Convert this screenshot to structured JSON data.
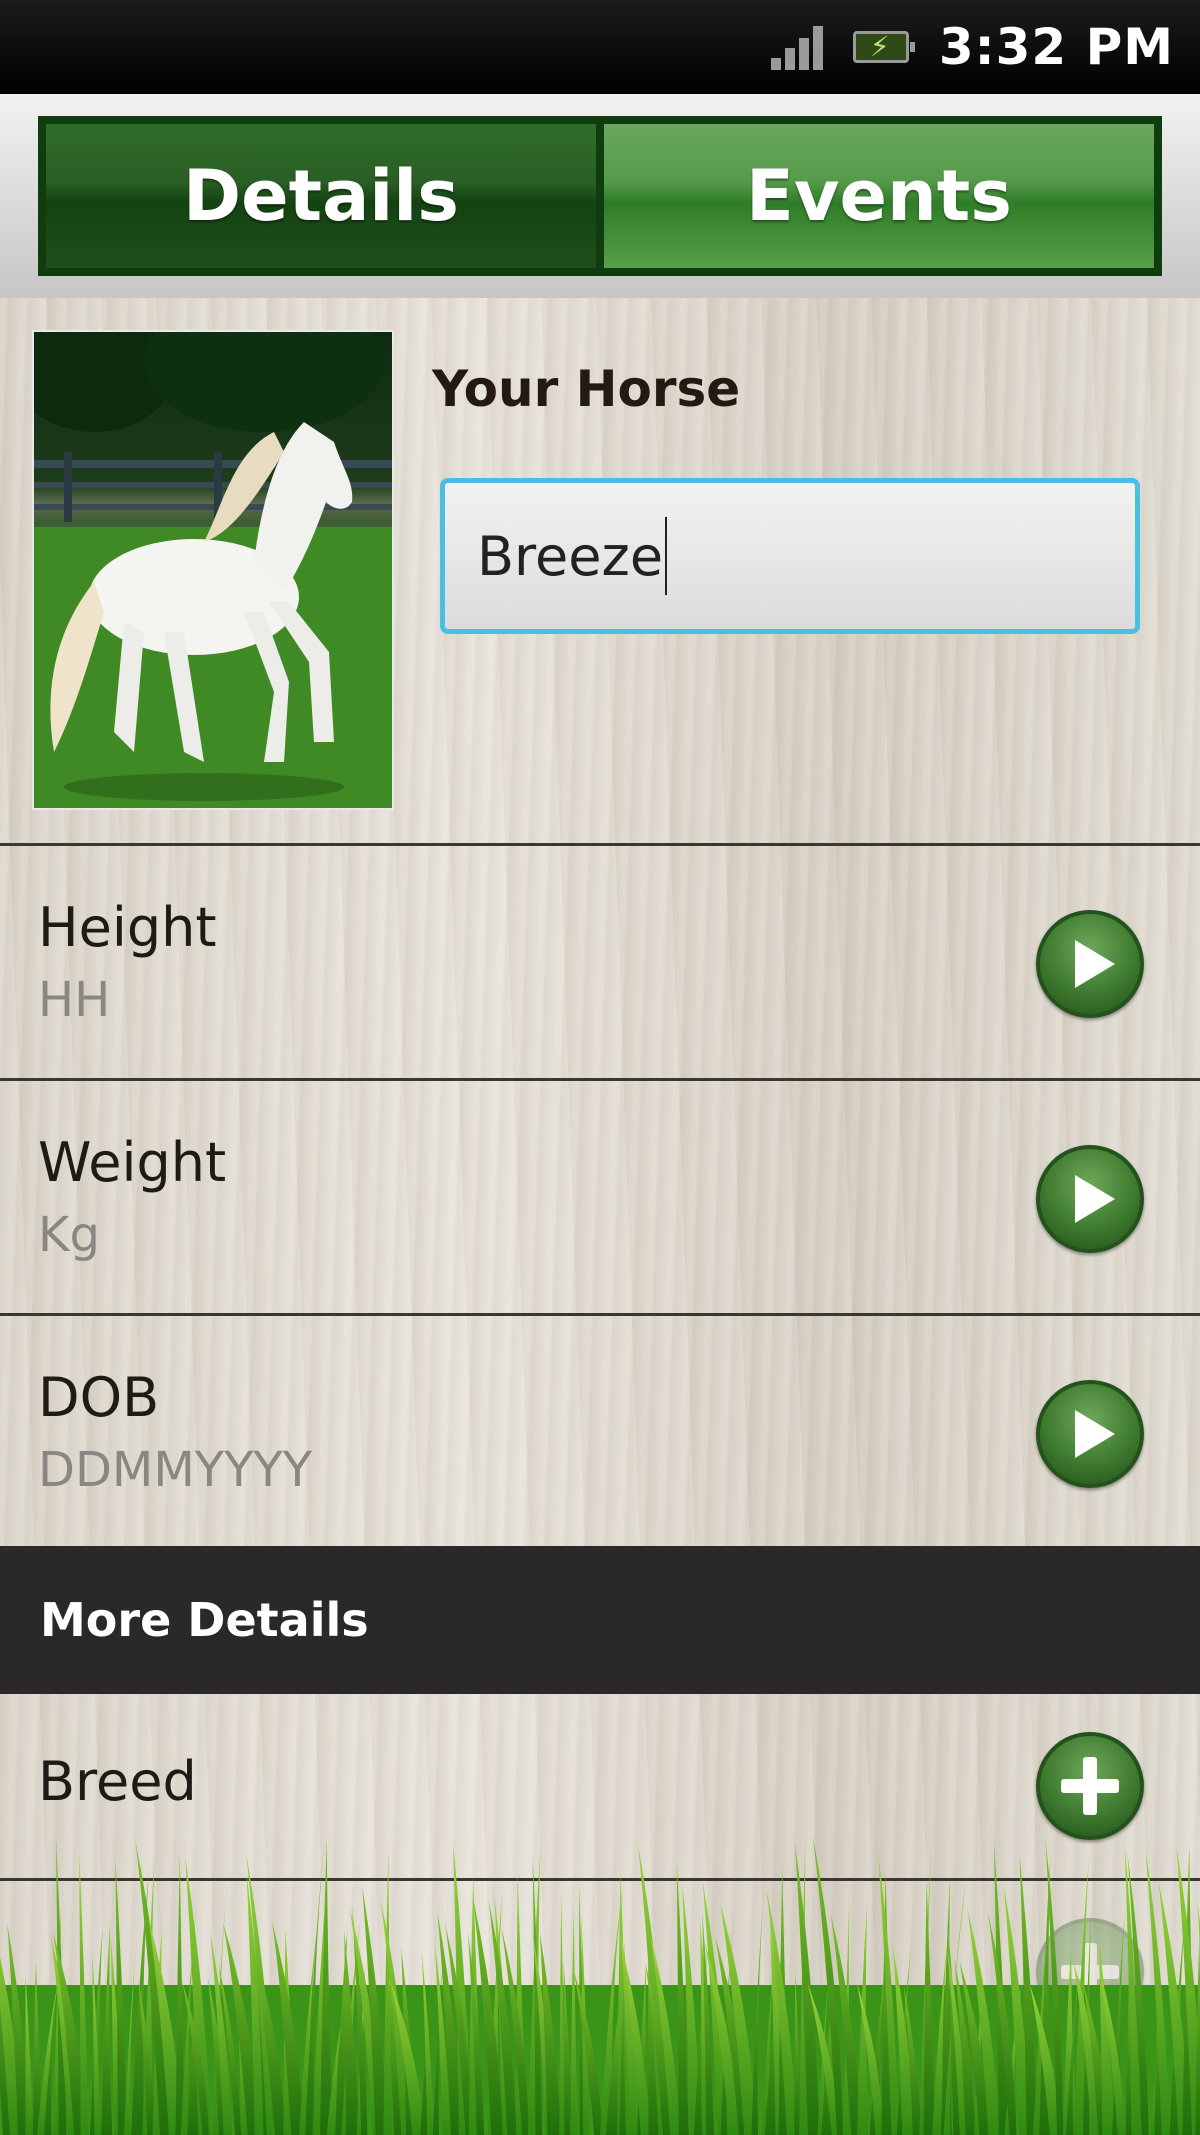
{
  "status_bar": {
    "time": "3:32 PM",
    "signal_icon": "signal-icon",
    "battery_icon": "battery-charging-icon"
  },
  "tabs": [
    {
      "label": "Details",
      "selected": true
    },
    {
      "label": "Events",
      "selected": false
    }
  ],
  "profile": {
    "photo": "horse-photo",
    "name_label": "Your Horse",
    "name_value": "Breeze"
  },
  "details": [
    {
      "title": "Height",
      "hint": "HH",
      "action_icon": "play-arrow-icon"
    },
    {
      "title": "Weight",
      "hint": "Kg",
      "action_icon": "play-arrow-icon"
    },
    {
      "title": "DOB",
      "hint": "DDMMYYYY",
      "action_icon": "play-arrow-icon"
    }
  ],
  "more_details": {
    "header": "More Details",
    "items": [
      {
        "title": "Breed",
        "action_icon": "plus-icon"
      }
    ]
  },
  "colors": {
    "tab_dark_green": "#134311",
    "tab_light_green": "#559a4a",
    "input_focus": "#49c0e3",
    "section_header_bg": "#2a2828"
  }
}
